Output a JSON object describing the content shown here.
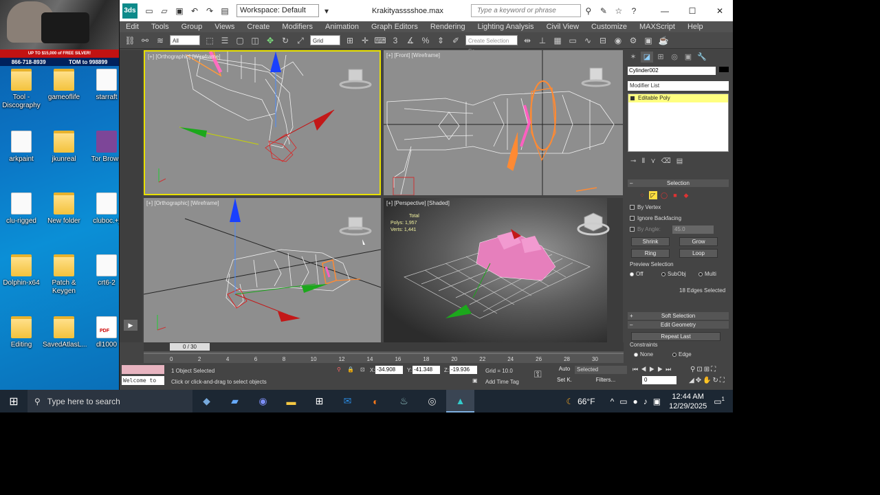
{
  "desktop": {
    "ad_banner": "UP TO $15,000 of FREE SILVER!",
    "phone_left": "866-718-8939",
    "phone_right": "TOM to 998899",
    "icons": [
      {
        "label": "Tool - Discography",
        "type": "folder"
      },
      {
        "label": "gameoflife",
        "type": "folder"
      },
      {
        "label": "starraft",
        "type": "file"
      },
      {
        "label": "arkpaint",
        "type": "file"
      },
      {
        "label": "jkunreal",
        "type": "folder"
      },
      {
        "label": "Tor Brows",
        "type": "tor"
      },
      {
        "label": "clu-rigged",
        "type": "file"
      },
      {
        "label": "New folder",
        "type": "folder"
      },
      {
        "label": "cluboc.+j",
        "type": "file"
      },
      {
        "label": "Dolphin-x64",
        "type": "folder"
      },
      {
        "label": "Patch & Keygen",
        "type": "folder"
      },
      {
        "label": "crt6-2",
        "type": "file"
      },
      {
        "label": "Editing",
        "type": "folder"
      },
      {
        "label": "SavedAtlasL...",
        "type": "folder"
      },
      {
        "label": "dl1000",
        "type": "pdf"
      }
    ]
  },
  "titlebar": {
    "logo": "3ds",
    "workspace": "Workspace: Default",
    "file_title": "Krakityasssshoe.max",
    "search_placeholder": "Type a keyword or phrase",
    "minimize": "—",
    "maximize": "☐",
    "close": "✕"
  },
  "menu": [
    "Edit",
    "Tools",
    "Group",
    "Views",
    "Create",
    "Modifiers",
    "Animation",
    "Graph Editors",
    "Rendering",
    "Lighting Analysis",
    "Civil View",
    "Customize",
    "MAXScript",
    "Help"
  ],
  "toolbar": {
    "filter": "All",
    "ref_coord": "Grid",
    "selection_set": "Create Selection Se"
  },
  "viewports": {
    "top": "[+] [Orthographic] [Wireframe]",
    "front": "[+] [Front] [Wireframe]",
    "left": "[+] [Orthographic] [Wireframe]",
    "perspective": "[+] [Perspective] [Shaded]",
    "stats": {
      "total": "Total",
      "polys_label": "Polys:",
      "polys": "1,957",
      "verts_label": "Verts:",
      "verts": "1,441"
    }
  },
  "command_panel": {
    "object_name": "Cylinder002",
    "modifier_list": "Modifier List",
    "modifier": "Editable Poly",
    "selection": {
      "header": "Selection",
      "by_vertex": "By Vertex",
      "ignore_backfacing": "Ignore Backfacing",
      "by_angle": "By Angle:",
      "angle_value": "45.0",
      "shrink": "Shrink",
      "grow": "Grow",
      "ring": "Ring",
      "loop": "Loop",
      "preview_selection": "Preview Selection",
      "preview_off": "Off",
      "preview_subobj": "SubObj",
      "preview_multi": "Multi",
      "status": "18 Edges Selected"
    },
    "soft_selection": "Soft Selection",
    "edit_geometry": "Edit Geometry",
    "repeat_last": "Repeat Last",
    "constraints": "Constraints",
    "constraint_none": "None",
    "constraint_edge": "Edge"
  },
  "timeline": {
    "frame": "0 / 30",
    "ticks": [
      "0",
      "2",
      "4",
      "6",
      "8",
      "10",
      "12",
      "14",
      "16",
      "18",
      "20",
      "22",
      "24",
      "26",
      "28",
      "30"
    ]
  },
  "status": {
    "listener": "Welcome to",
    "selected": "1 Object Selected",
    "prompt": "Click or click-and-drag to select objects",
    "x_label": "X:",
    "x": "-34.908",
    "y_label": "Y:",
    "y": "-41.348",
    "z_label": "Z:",
    "z": "-19.936",
    "grid": "Grid = 10.0",
    "add_time_tag": "Add Time Tag",
    "auto": "Auto",
    "set_key": "Set K.",
    "key_mode": "Selected",
    "filters": "Filters...",
    "frame_field": "0"
  },
  "taskbar": {
    "search": "Type here to search",
    "temperature": "66°F",
    "time": "12:44 AM",
    "date": "12/29/2025",
    "notifications": "1"
  }
}
